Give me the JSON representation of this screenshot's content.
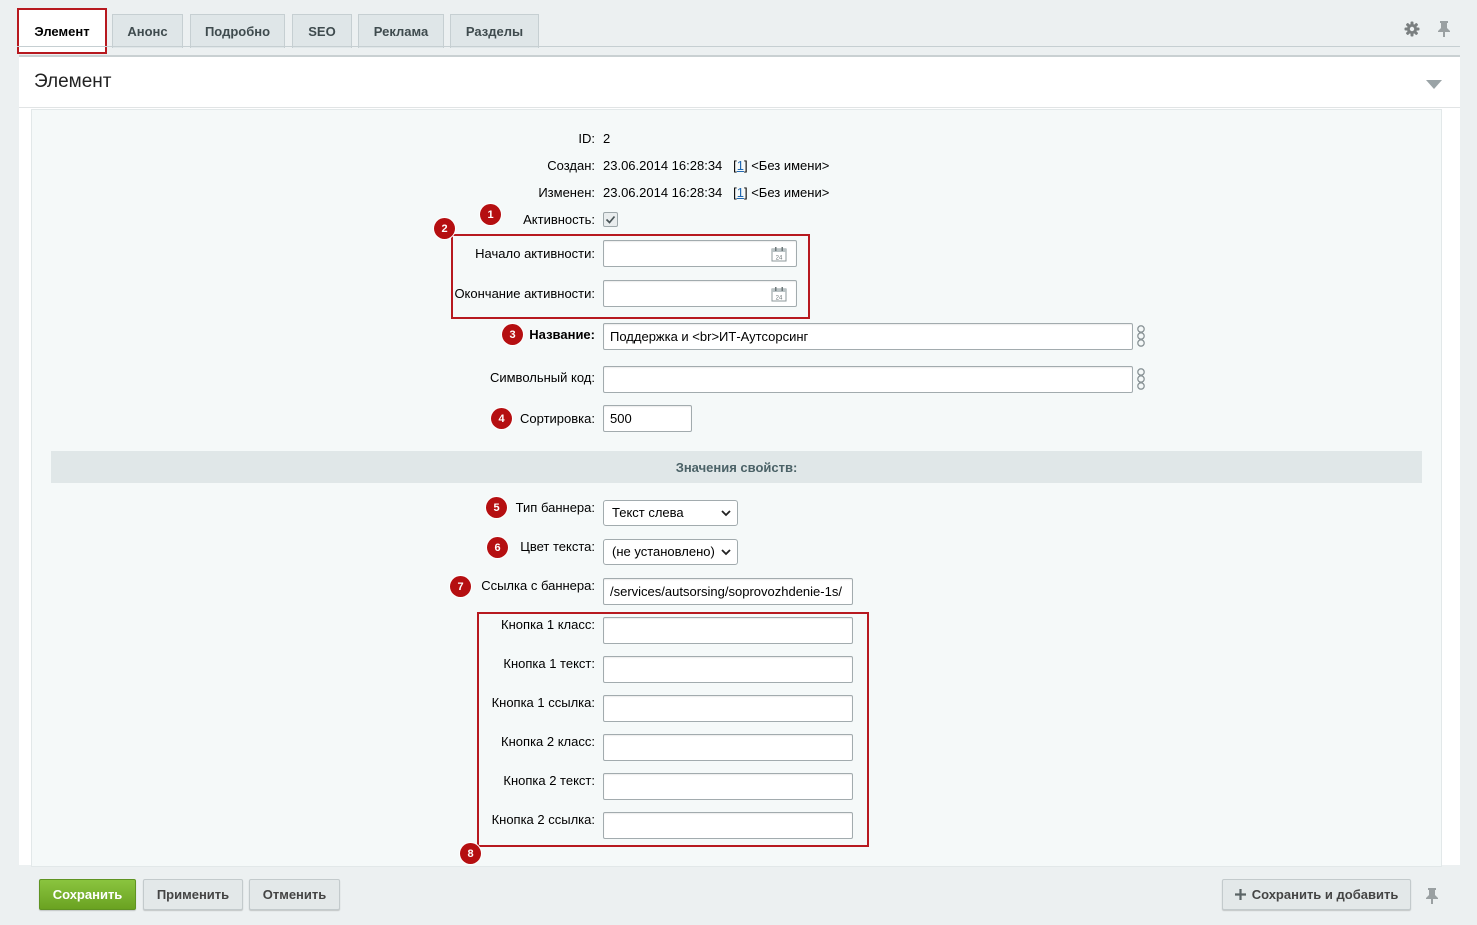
{
  "tabs": [
    {
      "label": "Элемент",
      "active": true
    },
    {
      "label": "Анонс"
    },
    {
      "label": "Подробно"
    },
    {
      "label": "SEO"
    },
    {
      "label": "Реклама"
    },
    {
      "label": "Разделы"
    }
  ],
  "header_icons": [
    "gear-icon",
    "pin-icon"
  ],
  "panel": {
    "title": "Элемент"
  },
  "fields": {
    "id": {
      "label": "ID:",
      "value": "2"
    },
    "created": {
      "label": "Создан:",
      "date": "23.06.2014 16:28:34",
      "user_link": "1",
      "user_name": "<Без имени>"
    },
    "modified": {
      "label": "Изменен:",
      "date": "23.06.2014 16:28:34",
      "user_link": "1",
      "user_name": "<Без имени>"
    },
    "active": {
      "label": "Активность:",
      "checked": true
    },
    "active_from": {
      "label": "Начало активности:",
      "value": ""
    },
    "active_to": {
      "label": "Окончание активности:",
      "value": ""
    },
    "name": {
      "label": "Название:",
      "value": "Поддержка и <br>ИТ-Аутсорсинг"
    },
    "code": {
      "label": "Символьный код:",
      "value": ""
    },
    "sort": {
      "label": "Сортировка:",
      "value": "500"
    }
  },
  "properties": {
    "section_title": "Значения свойств:",
    "banner_type": {
      "label": "Тип баннера:",
      "selected": "Текст слева"
    },
    "text_color": {
      "label": "Цвет текста:",
      "selected": "(не установлено)"
    },
    "banner_link": {
      "label": "Ссылка с баннера:",
      "value": "/services/autsorsing/soprovozhdenie-1s/"
    },
    "btn1_class": {
      "label": "Кнопка 1 класс:",
      "value": ""
    },
    "btn1_text": {
      "label": "Кнопка 1 текст:",
      "value": ""
    },
    "btn1_link": {
      "label": "Кнопка 1 ссылка:",
      "value": ""
    },
    "btn2_class": {
      "label": "Кнопка 2 класс:",
      "value": ""
    },
    "btn2_text": {
      "label": "Кнопка 2 текст:",
      "value": ""
    },
    "btn2_link": {
      "label": "Кнопка 2 ссылка:",
      "value": ""
    }
  },
  "badges": [
    "1",
    "2",
    "3",
    "4",
    "5",
    "6",
    "7",
    "8"
  ],
  "footer": {
    "save": "Сохранить",
    "apply": "Применить",
    "cancel": "Отменить",
    "save_add": "Сохранить и добавить"
  },
  "colors": {
    "highlight": "#b7191f",
    "badge": "#b50f11",
    "primary_button": "#7ab530"
  }
}
